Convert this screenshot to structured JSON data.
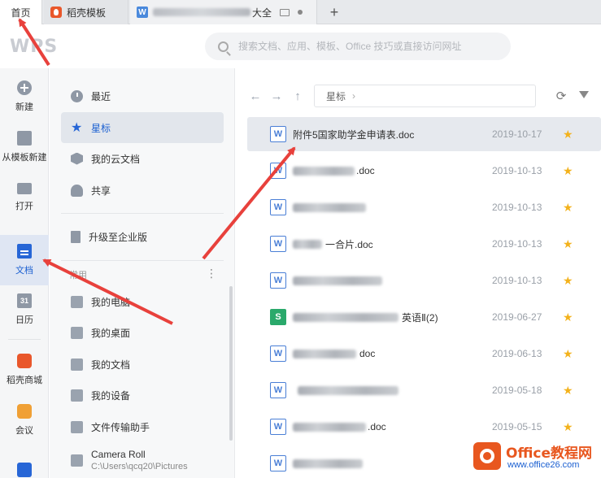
{
  "tabs": [
    {
      "label": "首页"
    },
    {
      "label": "稻壳模板"
    },
    {
      "label_visible_suffix": "大全"
    }
  ],
  "header": {
    "logo": "WPS",
    "search_placeholder": "搜索文档、应用、模板、Office 技巧或直接访问网址"
  },
  "rail": [
    {
      "label": "新建",
      "icon": "plus-circle-icon"
    },
    {
      "label": "从模板新建",
      "icon": "template-icon"
    },
    {
      "label": "打开",
      "icon": "folder-icon"
    },
    {
      "label": "文档",
      "icon": "document-icon",
      "active": true
    },
    {
      "label": "日历",
      "icon": "calendar-icon",
      "icon_text": "31"
    },
    {
      "label": "稻壳商城",
      "icon": "mall-icon"
    },
    {
      "label": "会议",
      "icon": "meeting-icon"
    }
  ],
  "nav": {
    "items": [
      {
        "label": "最近",
        "icon": "clock-icon"
      },
      {
        "label": "星标",
        "icon": "star-icon",
        "active": true
      },
      {
        "label": "我的云文档",
        "icon": "cloud-icon"
      },
      {
        "label": "共享",
        "icon": "share-icon"
      },
      {
        "label": "升级至企业版",
        "icon": "enterprise-icon"
      }
    ],
    "group_label": "常用",
    "kebab": "⋮",
    "locations": [
      {
        "label": "我的电脑"
      },
      {
        "label": "我的桌面"
      },
      {
        "label": "我的文档"
      },
      {
        "label": "我的设备"
      },
      {
        "label": "文件传输助手"
      },
      {
        "label": "Camera Roll",
        "sub": "C:\\Users\\qcq20\\Pictures"
      }
    ]
  },
  "toolbar": {
    "breadcrumb": "星标",
    "chevron": "›"
  },
  "files": [
    {
      "name": "附件5国家助学金申请表.doc",
      "type": "W",
      "date": "2019-10-17",
      "selected": true
    },
    {
      "name_suffix": ".doc",
      "type": "W",
      "date": "2019-10-13"
    },
    {
      "name_suffix": "",
      "type": "W",
      "date": "2019-10-13"
    },
    {
      "name": "一合片.doc",
      "type": "W",
      "date": "2019-10-13"
    },
    {
      "name_suffix": "",
      "type": "W",
      "date": "2019-10-13"
    },
    {
      "name_suffix": "英语Ⅱ(2)",
      "type": "S",
      "date": "2019-06-27"
    },
    {
      "name_suffix": "doc",
      "type": "W",
      "date": "2019-06-13"
    },
    {
      "name_suffix": "",
      "type": "W",
      "date": "2019-05-18"
    },
    {
      "name_suffix": ".doc",
      "type": "W",
      "date": "2019-05-15"
    },
    {
      "name_suffix": "",
      "type": "W",
      "date": ""
    }
  ],
  "watermark": {
    "title": "Office教程网",
    "url": "www.office26.com"
  },
  "colors": {
    "accent": "#1a5fd1",
    "star": "#f3b21c",
    "annotation_arrow": "#e8413c"
  }
}
